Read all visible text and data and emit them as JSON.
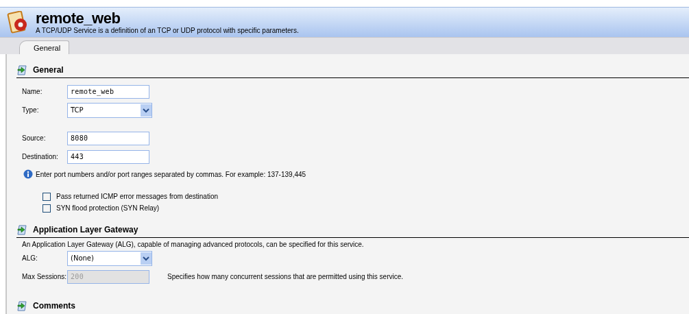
{
  "header": {
    "title": "remote_web",
    "subtitle": "A TCP/UDP Service is a definition of an TCP or UDP protocol with specific parameters."
  },
  "tabs": [
    {
      "label": "General",
      "selected": true
    }
  ],
  "general": {
    "title": "General",
    "field_groups": [
      [
        {
          "label": "Name:",
          "kind": "text",
          "value": "remote_web"
        },
        {
          "label": "Type:",
          "kind": "select",
          "value": "TCP"
        }
      ],
      [
        {
          "label": "Source:",
          "kind": "text",
          "value": "8080"
        },
        {
          "label": "Destination:",
          "kind": "text",
          "value": "443"
        }
      ]
    ],
    "info": "Enter port numbers and/or port ranges separated by commas. For example: 137-139,445",
    "checkboxes": [
      {
        "label": "Pass returned ICMP error messages from destination",
        "checked": false
      },
      {
        "label": "SYN flood protection (SYN Relay)",
        "checked": false
      }
    ]
  },
  "alg": {
    "title": "Application Layer Gateway",
    "description": "An Application Layer Gateway (ALG), capable of managing advanced protocols, can be specified for this service.",
    "fields": [
      {
        "label": "ALG:",
        "kind": "select",
        "value": "(None)",
        "disabled": false
      },
      {
        "label": "Max Sessions:",
        "kind": "text",
        "value": "200",
        "disabled": true,
        "hint": "Specifies how many concurrent sessions that are permitted using this service."
      }
    ]
  },
  "comments": {
    "title": "Comments"
  }
}
